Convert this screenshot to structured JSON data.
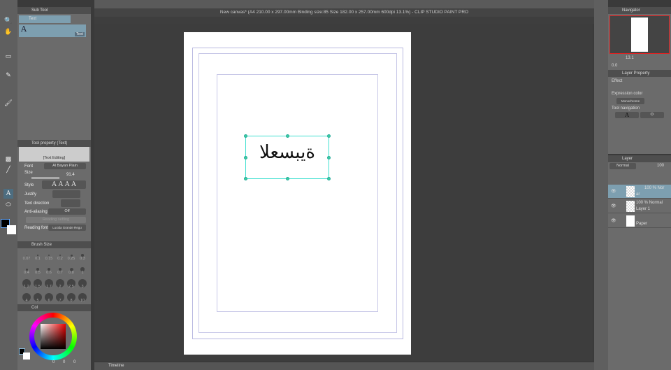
{
  "window": {
    "title": "New canvas* (A4 210.00 x 297.00mm Binding size:85 Size 182.00 x 257.00mm 600dpi 13.1%)  - CLIP STUDIO PAINT PRO"
  },
  "subtool": {
    "title": "Sub Tool",
    "group": "Text",
    "item": "Text",
    "item_tag": "Text"
  },
  "tool_property": {
    "title": "Tool property (Text)",
    "preview": "[Text Editing]",
    "font_label": "Font",
    "font_value": "Al Bayan Plain",
    "size_label": "Size",
    "size_value": "91.4",
    "style_label": "Style",
    "justify_label": "Justify",
    "direction_label": "Text direction",
    "aa_label": "Anti-aliasing",
    "aa_value": "Off",
    "reading_setting": "Reading setting",
    "reading_font_label": "Reading font",
    "reading_font_value": "Lucida Grande Regu"
  },
  "brush_size": {
    "title": "Brush Size",
    "values": [
      "0.07",
      "0.1",
      "0.15",
      "0.2",
      "0.25",
      "0.3",
      "0.4",
      "0.5",
      "0.6",
      "0.7",
      "0.8",
      "1",
      "1.2",
      "1.5",
      "1.7",
      "2",
      "2.5",
      "3",
      "4",
      "5",
      "6",
      "7",
      "8",
      "10"
    ]
  },
  "color": {
    "tab": "Col",
    "values": [
      "0",
      "0",
      "0"
    ],
    "fg": "#000000",
    "bg": "#ffffff"
  },
  "canvas": {
    "text": "العسبية",
    "accent": "#3ee0d0"
  },
  "navigator": {
    "title": "Navigator",
    "zoom": "13.1",
    "angle": "0.0"
  },
  "layer_property": {
    "title": "Layer Property",
    "effect": "Effect",
    "expression_color": "Expression color",
    "expression_value": "Monochrome",
    "tool_navigation": "Tool navigation"
  },
  "layer": {
    "title": "Layer",
    "blend": "Normal",
    "opacity": "100",
    "layers": [
      {
        "mode": "100 % Nor",
        "name": "ar"
      },
      {
        "mode": "100 % Normal",
        "name": "Layer 1"
      },
      {
        "mode": "",
        "name": "Paper"
      }
    ]
  },
  "timeline": {
    "label": "Timeline"
  }
}
